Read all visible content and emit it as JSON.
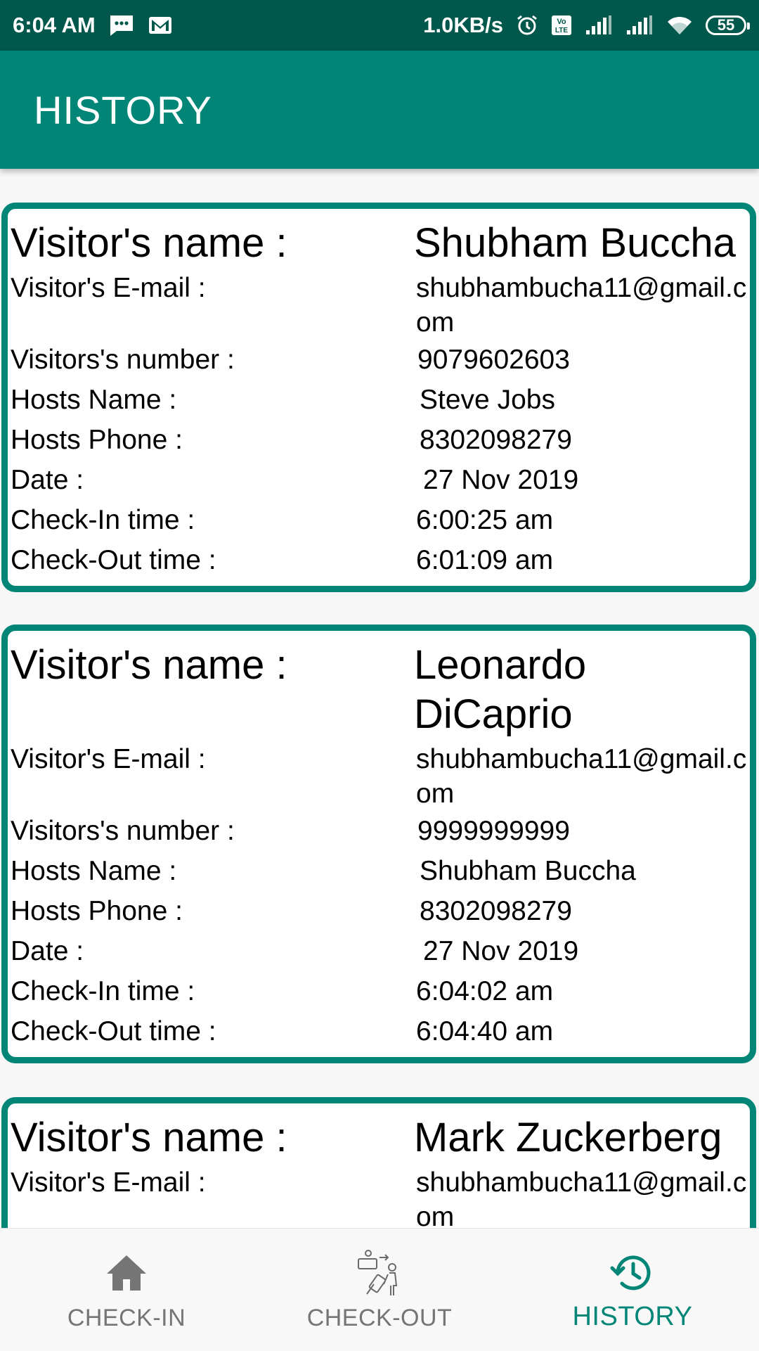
{
  "status_bar": {
    "time": "6:04 AM",
    "net_speed": "1.0KB/s",
    "battery": "55",
    "left_icons": [
      "message-icon",
      "gmail-icon"
    ],
    "right_icons": [
      "alarm-icon",
      "volte-icon",
      "signal-icon",
      "signal-icon",
      "wifi-icon",
      "battery-icon"
    ]
  },
  "app_bar": {
    "title": "HISTORY"
  },
  "labels": {
    "name": "Visitor's name :",
    "email": "Visitor's E-mail :",
    "number": "Visitors's number :",
    "host_name": "Hosts Name :",
    "host_phone": "Hosts Phone :",
    "date": "Date :",
    "checkin": "Check-In time :",
    "checkout": "Check-Out time :"
  },
  "entries": [
    {
      "name": "Shubham Buccha",
      "email": "shubhambucha11@gmail.com",
      "number": "9079602603",
      "host_name": "Steve Jobs",
      "host_phone": "8302098279",
      "date": "27 Nov 2019",
      "checkin": "6:00:25 am",
      "checkout": "6:01:09 am"
    },
    {
      "name": "Leonardo DiCaprio",
      "email": "shubhambucha11@gmail.com",
      "number": "9999999999",
      "host_name": "Shubham Buccha",
      "host_phone": "8302098279",
      "date": "27 Nov 2019",
      "checkin": "6:04:02 am",
      "checkout": "6:04:40 am"
    },
    {
      "name": "Mark Zuckerberg",
      "email": "shubhambucha11@gmail.com"
    }
  ],
  "bottom_nav": {
    "items": [
      {
        "label": "CHECK-IN",
        "icon": "home-icon",
        "active": false
      },
      {
        "label": "CHECK-OUT",
        "icon": "checkout-person-icon",
        "active": false
      },
      {
        "label": "HISTORY",
        "icon": "history-icon",
        "active": true
      }
    ],
    "active_color": "#008577",
    "inactive_color": "#757575"
  },
  "colors": {
    "primary": "#008577",
    "primary_dark": "#00574b",
    "background": "#f7f7f7"
  }
}
